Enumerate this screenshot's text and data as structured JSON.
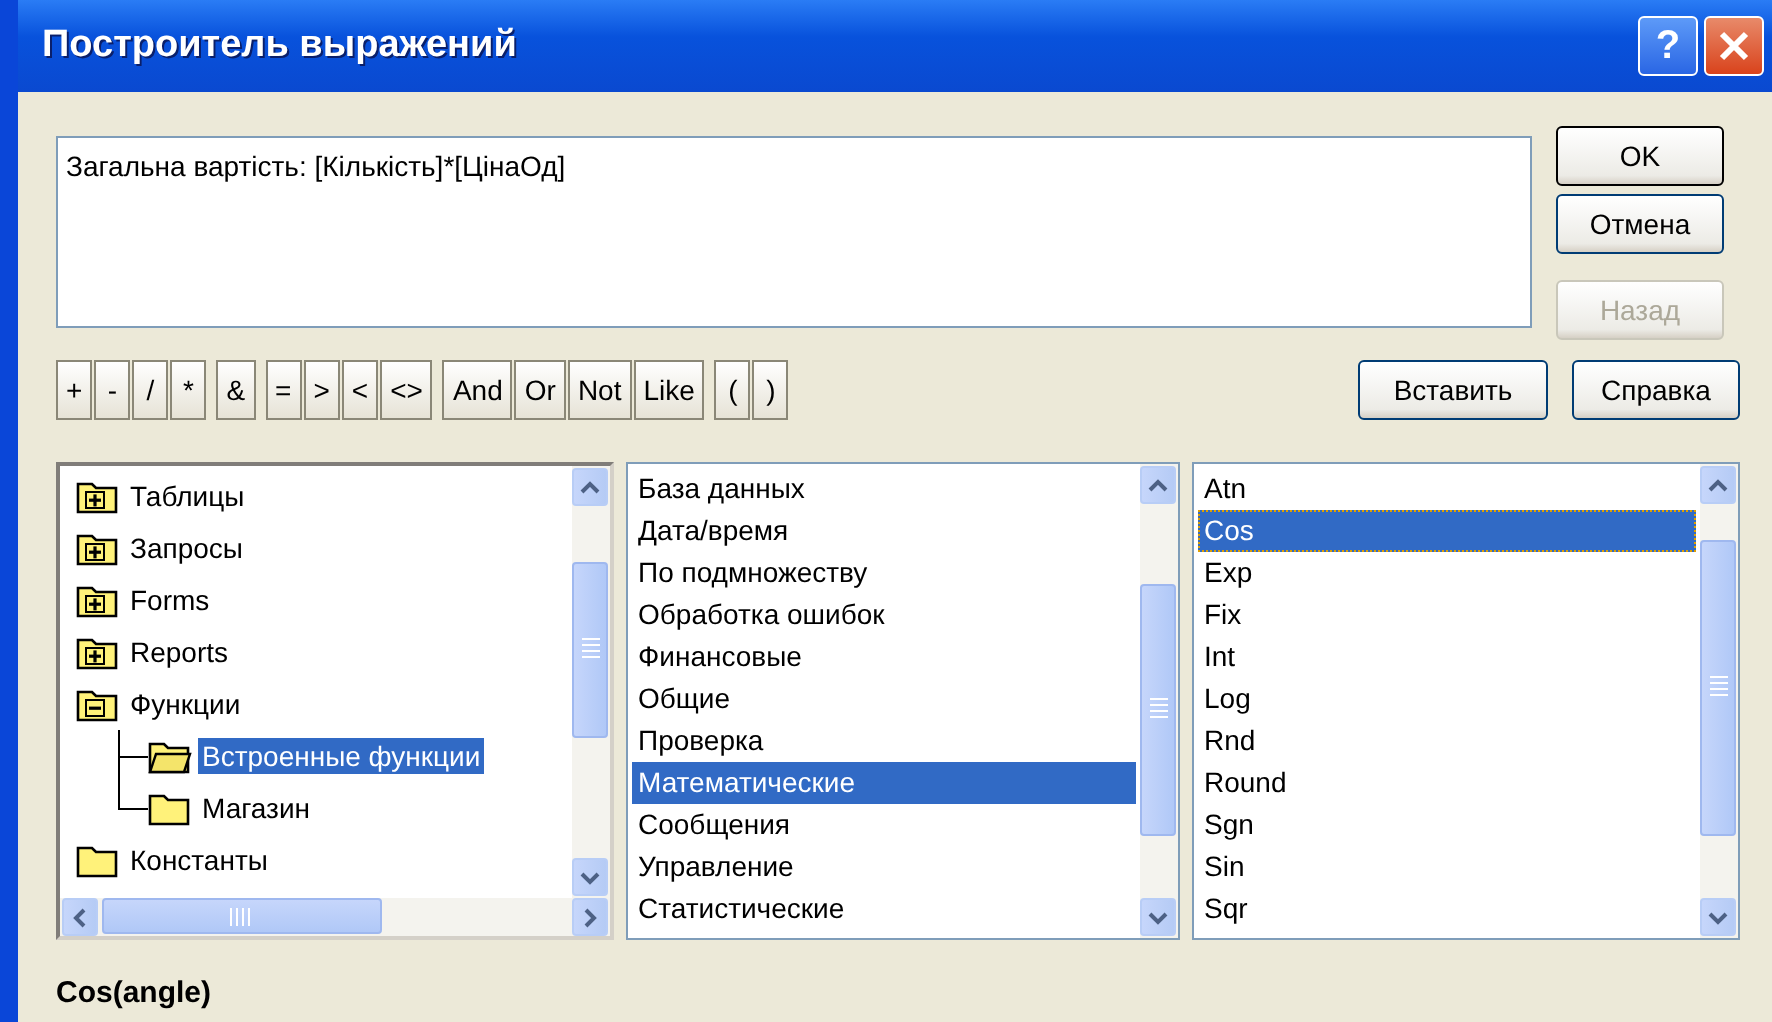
{
  "window": {
    "title": "Построитель выражений",
    "help_label": "?"
  },
  "expression": "Загальна вартість: [Кількість]*[ЦінаОд]",
  "side_buttons": [
    {
      "label": "OK",
      "disabled": false,
      "default": true
    },
    {
      "label": "Отмена",
      "disabled": false,
      "default": false
    },
    {
      "label": "Назад",
      "disabled": true,
      "default": false
    }
  ],
  "operator_groups": [
    [
      "+",
      "-",
      "/",
      "*"
    ],
    [
      "&"
    ],
    [
      "=",
      ">",
      "<",
      "<>"
    ],
    [
      "And",
      "Or",
      "Not",
      "Like"
    ],
    [
      "(",
      ")"
    ]
  ],
  "action_buttons": [
    "Вставить",
    "Справка"
  ],
  "tree": [
    {
      "label": "Таблицы",
      "kind": "expandable",
      "expanded": false,
      "selected": false
    },
    {
      "label": "Запросы",
      "kind": "expandable",
      "expanded": false,
      "selected": false
    },
    {
      "label": "Forms",
      "kind": "expandable",
      "expanded": false,
      "selected": false
    },
    {
      "label": "Reports",
      "kind": "expandable",
      "expanded": false,
      "selected": false
    },
    {
      "label": "Функции",
      "kind": "expandable",
      "expanded": true,
      "selected": false,
      "children": [
        {
          "label": "Встроенные функции",
          "kind": "folder",
          "selected": true
        },
        {
          "label": "Магазин",
          "kind": "folder",
          "selected": false
        }
      ]
    },
    {
      "label": "Константы",
      "kind": "folder",
      "selected": false
    }
  ],
  "categories": [
    {
      "label": "База данных",
      "selected": false
    },
    {
      "label": "Дата/время",
      "selected": false
    },
    {
      "label": "По подмножеству",
      "selected": false
    },
    {
      "label": "Обработка ошибок",
      "selected": false
    },
    {
      "label": "Финансовые",
      "selected": false
    },
    {
      "label": "Общие",
      "selected": false
    },
    {
      "label": "Проверка",
      "selected": false
    },
    {
      "label": "Математические",
      "selected": true
    },
    {
      "label": "Сообщения",
      "selected": false
    },
    {
      "label": "Управление",
      "selected": false
    },
    {
      "label": "Статистические",
      "selected": false
    }
  ],
  "functions": [
    {
      "label": "Atn",
      "selected": false
    },
    {
      "label": "Cos",
      "selected": true
    },
    {
      "label": "Exp",
      "selected": false
    },
    {
      "label": "Fix",
      "selected": false
    },
    {
      "label": "Int",
      "selected": false
    },
    {
      "label": "Log",
      "selected": false
    },
    {
      "label": "Rnd",
      "selected": false
    },
    {
      "label": "Round",
      "selected": false
    },
    {
      "label": "Sgn",
      "selected": false
    },
    {
      "label": "Sin",
      "selected": false
    },
    {
      "label": "Sqr",
      "selected": false
    }
  ],
  "status": "Cos(angle)"
}
